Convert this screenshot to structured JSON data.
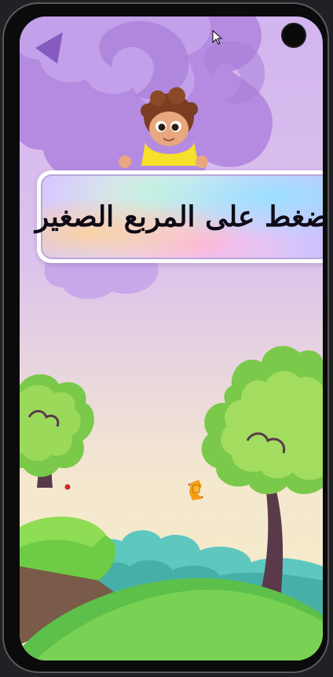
{
  "instruction": {
    "text": "اضغط على المربع الصغير"
  },
  "game": {
    "target": "small-square",
    "target_color": "#f39c12"
  },
  "colors": {
    "sky_top": "#d3b5ef",
    "sky_bottom": "#f7ecc7",
    "grass": "#5cc04a",
    "banner_border": "#ffffff"
  }
}
